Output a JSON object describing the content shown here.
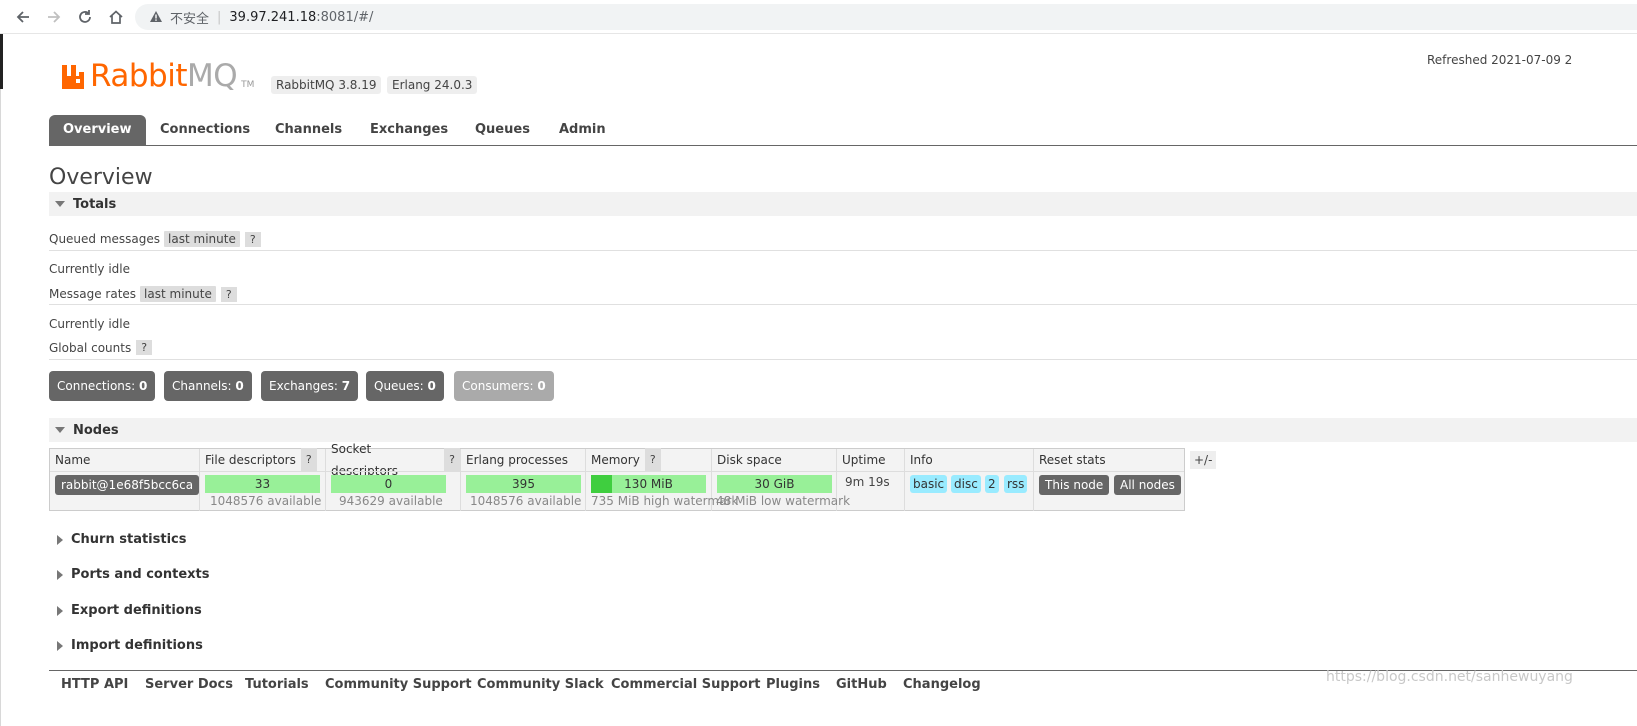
{
  "browser": {
    "insecure_label": "不安全",
    "separator": "|",
    "url_host": "39.97.241.18",
    "url_path": ":8081/#/"
  },
  "header": {
    "logo_rabbit": "RabbitMQ",
    "logo_rabbit_part": "Rabbit",
    "logo_mq_part": "MQ",
    "logo_tm": "TM",
    "rabbitmq_version": "RabbitMQ 3.8.19",
    "erlang_version": "Erlang 24.0.3",
    "refreshed": "Refreshed 2021-07-09 2"
  },
  "tabs": [
    "Overview",
    "Connections",
    "Channels",
    "Exchanges",
    "Queues",
    "Admin"
  ],
  "page_title": "Overview",
  "totals": {
    "title": "Totals",
    "queued_messages": "Queued messages",
    "queued_range": "last minute",
    "help": "?",
    "idle1": "Currently idle",
    "message_rates": "Message rates",
    "rates_range": "last minute",
    "idle2": "Currently idle",
    "global_counts": "Global counts"
  },
  "counts": [
    {
      "label": "Connections:",
      "value": "0"
    },
    {
      "label": "Channels:",
      "value": "0"
    },
    {
      "label": "Exchanges:",
      "value": "7"
    },
    {
      "label": "Queues:",
      "value": "0"
    },
    {
      "label": "Consumers:",
      "value": "0"
    }
  ],
  "nodes": {
    "title": "Nodes",
    "headers": [
      "Name",
      "File descriptors",
      "Socket descriptors",
      "Erlang processes",
      "Memory",
      "Disk space",
      "Uptime",
      "Info",
      "Reset stats"
    ],
    "plusminus": "+/-",
    "row": {
      "name": "rabbit@1e68f5bcc6ca",
      "file_descriptors": "33",
      "file_available": "1048576 available",
      "socket_descriptors": "0",
      "socket_available": "943629 available",
      "erlang_processes": "395",
      "erlang_available": "1048576 available",
      "memory": "130 MiB",
      "memory_fraction": 0.18,
      "memory_watermark": "735 MiB high watermark",
      "disk": "30 GiB",
      "disk_watermark": "48 MiB low watermark",
      "uptime": "9m 19s",
      "info_tags": [
        "basic",
        "disc",
        "2",
        "rss"
      ],
      "reset_this": "This node",
      "reset_all": "All nodes"
    }
  },
  "collapsed_sections": [
    "Churn statistics",
    "Ports and contexts",
    "Export definitions",
    "Import definitions"
  ],
  "footer": [
    "HTTP API",
    "Server Docs",
    "Tutorials",
    "Community Support",
    "Community Slack",
    "Commercial Support",
    "Plugins",
    "GitHub",
    "Changelog"
  ],
  "watermark": "https://blog.csdn.net/sanhewuyang",
  "colors": {
    "brand_orange": "#ff6600",
    "tab_active": "#666666",
    "bar_green": "#98f098",
    "info_blue": "#99ebff"
  }
}
